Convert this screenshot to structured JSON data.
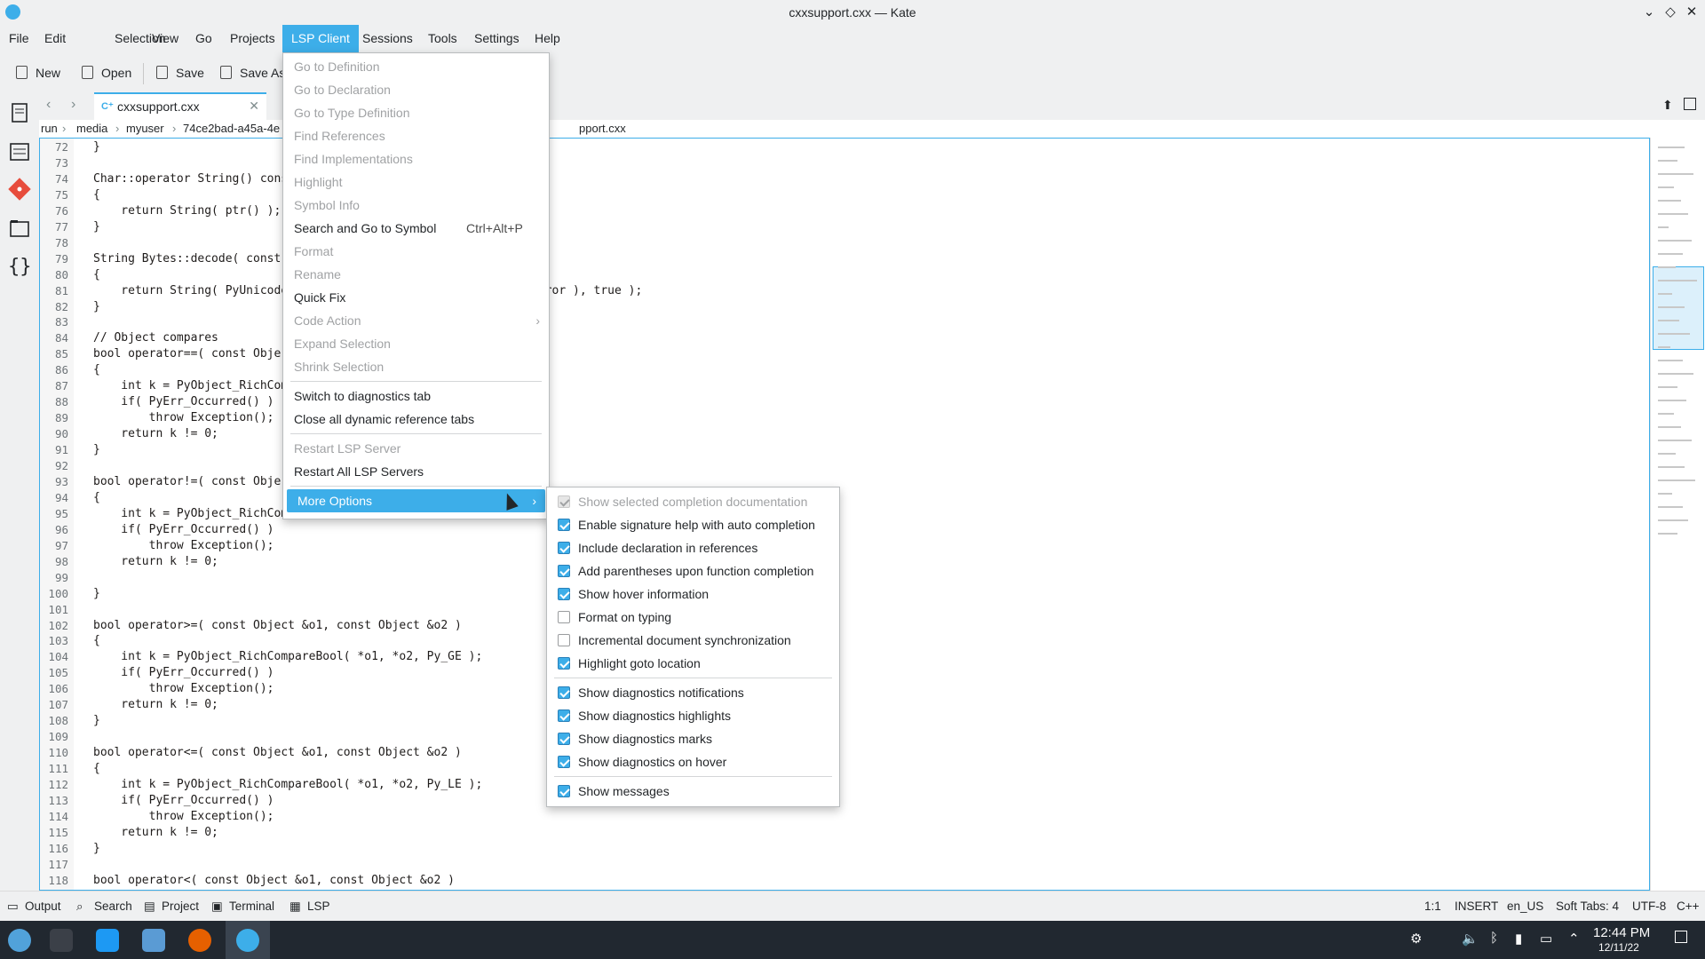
{
  "window": {
    "title": "cxxsupport.cxx — Kate"
  },
  "menubar": [
    "File",
    "Edit",
    "Selection",
    "View",
    "Go",
    "Projects",
    "LSP Client",
    "Sessions",
    "Tools",
    "Settings",
    "Help"
  ],
  "toolbar": {
    "new": "New",
    "open": "Open",
    "save": "Save",
    "save_as": "Save As"
  },
  "tab": {
    "label": "cxxsupport.cxx",
    "close": "✕"
  },
  "breadcrumb": {
    "items": [
      "run",
      "media",
      "myuser",
      "74ce2bad-a45a-4e",
      "pport.cxx"
    ]
  },
  "editor": {
    "lines": [
      {
        "n": "72",
        "t": "}"
      },
      {
        "n": "73",
        "t": ""
      },
      {
        "n": "74",
        "t": "Char::operator String() cons"
      },
      {
        "n": "75",
        "t": "{"
      },
      {
        "n": "76",
        "t": "    return String( ptr() );"
      },
      {
        "n": "77",
        "t": "}"
      },
      {
        "n": "78",
        "t": ""
      },
      {
        "n": "79",
        "t": "String Bytes::decode( const"
      },
      {
        "n": "80",
        "t": "{"
      },
      {
        "n": "81",
        "t": "    return String( PyUnicode                                    rror ), true );"
      },
      {
        "n": "82",
        "t": "}"
      },
      {
        "n": "83",
        "t": ""
      },
      {
        "n": "84",
        "t": "// Object compares"
      },
      {
        "n": "85",
        "t": "bool operator==( const Obje"
      },
      {
        "n": "86",
        "t": "{"
      },
      {
        "n": "87",
        "t": "    int k = PyObject_RichCom"
      },
      {
        "n": "88",
        "t": "    if( PyErr_Occurred() )"
      },
      {
        "n": "89",
        "t": "        throw Exception();"
      },
      {
        "n": "90",
        "t": "    return k != 0;"
      },
      {
        "n": "91",
        "t": "}"
      },
      {
        "n": "92",
        "t": ""
      },
      {
        "n": "93",
        "t": "bool operator!=( const Obje"
      },
      {
        "n": "94",
        "t": "{"
      },
      {
        "n": "95",
        "t": "    int k = PyObject_RichCom"
      },
      {
        "n": "96",
        "t": "    if( PyErr_Occurred() )"
      },
      {
        "n": "97",
        "t": "        throw Exception();"
      },
      {
        "n": "98",
        "t": "    return k != 0;"
      },
      {
        "n": "99",
        "t": ""
      },
      {
        "n": "100",
        "t": "}"
      },
      {
        "n": "101",
        "t": ""
      },
      {
        "n": "102",
        "t": "bool operator>=( const Object &o1, const Object &o2 )"
      },
      {
        "n": "103",
        "t": "{"
      },
      {
        "n": "104",
        "t": "    int k = PyObject_RichCompareBool( *o1, *o2, Py_GE );"
      },
      {
        "n": "105",
        "t": "    if( PyErr_Occurred() )"
      },
      {
        "n": "106",
        "t": "        throw Exception();"
      },
      {
        "n": "107",
        "t": "    return k != 0;"
      },
      {
        "n": "108",
        "t": "}"
      },
      {
        "n": "109",
        "t": ""
      },
      {
        "n": "110",
        "t": "bool operator<=( const Object &o1, const Object &o2 )"
      },
      {
        "n": "111",
        "t": "{"
      },
      {
        "n": "112",
        "t": "    int k = PyObject_RichCompareBool( *o1, *o2, Py_LE );"
      },
      {
        "n": "113",
        "t": "    if( PyErr_Occurred() )"
      },
      {
        "n": "114",
        "t": "        throw Exception();"
      },
      {
        "n": "115",
        "t": "    return k != 0;"
      },
      {
        "n": "116",
        "t": "}"
      },
      {
        "n": "117",
        "t": ""
      },
      {
        "n": "118",
        "t": "bool operator<( const Object &o1, const Object &o2 )"
      }
    ]
  },
  "lsp_menu": {
    "items": [
      {
        "label": "Go to Definition",
        "enabled": false
      },
      {
        "label": "Go to Declaration",
        "enabled": false
      },
      {
        "label": "Go to Type Definition",
        "enabled": false
      },
      {
        "label": "Find References",
        "enabled": false
      },
      {
        "label": "Find Implementations",
        "enabled": false
      },
      {
        "label": "Highlight",
        "enabled": false
      },
      {
        "label": "Symbol Info",
        "enabled": false
      },
      {
        "label": "Search and Go to Symbol",
        "enabled": true,
        "shortcut": "Ctrl+Alt+P"
      },
      {
        "label": "Format",
        "enabled": false
      },
      {
        "label": "Rename",
        "enabled": false
      },
      {
        "label": "Quick Fix",
        "enabled": true
      },
      {
        "label": "Code Action",
        "enabled": false,
        "submenu": true
      },
      {
        "label": "Expand Selection",
        "enabled": false
      },
      {
        "label": "Shrink Selection",
        "enabled": false
      },
      {
        "label": "Switch to diagnostics tab",
        "enabled": true
      },
      {
        "label": "Close all dynamic reference tabs",
        "enabled": true
      },
      {
        "label": "Restart LSP Server",
        "enabled": false
      },
      {
        "label": "Restart All LSP Servers",
        "enabled": true
      },
      {
        "label": "More Options",
        "enabled": true,
        "submenu": true,
        "highlighted": true
      }
    ]
  },
  "more_options": {
    "items": [
      {
        "label": "Show selected completion documentation",
        "checked": true,
        "enabled": false
      },
      {
        "label": "Enable signature help with auto completion",
        "checked": true,
        "enabled": true
      },
      {
        "label": "Include declaration in references",
        "checked": true,
        "enabled": true
      },
      {
        "label": "Add parentheses upon function completion",
        "checked": true,
        "enabled": true
      },
      {
        "label": "Show hover information",
        "checked": true,
        "enabled": true
      },
      {
        "label": "Format on typing",
        "checked": false,
        "enabled": true
      },
      {
        "label": "Incremental document synchronization",
        "checked": false,
        "enabled": true
      },
      {
        "label": "Highlight goto location",
        "checked": true,
        "enabled": true
      },
      {
        "label": "Show diagnostics notifications",
        "checked": true,
        "enabled": true
      },
      {
        "label": "Show diagnostics highlights",
        "checked": true,
        "enabled": true
      },
      {
        "label": "Show diagnostics marks",
        "checked": true,
        "enabled": true
      },
      {
        "label": "Show diagnostics on hover",
        "checked": true,
        "enabled": true
      },
      {
        "label": "Show messages",
        "checked": true,
        "enabled": true
      }
    ]
  },
  "bottom_panel": {
    "output": "Output",
    "search": "Search",
    "project": "Project",
    "terminal": "Terminal",
    "lsp": "LSP"
  },
  "status": {
    "position": "1:1",
    "mode": "INSERT",
    "language": "en_US",
    "indent": "Soft Tabs: 4",
    "encoding": "UTF-8",
    "syntax": "C++"
  },
  "taskbar": {
    "time": "12:44 PM",
    "date": "12/11/22"
  },
  "colors": {
    "accent": "#3daee9",
    "taskbar": "#212830"
  }
}
